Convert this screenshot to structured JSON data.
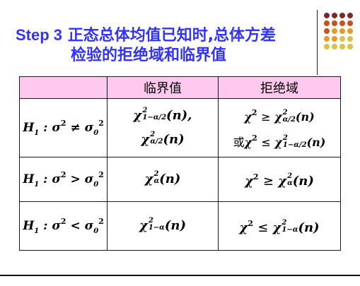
{
  "title": {
    "step": "Step 3",
    "line1": "正态总体均值已知时,总体方差",
    "line2": "检验的拒绝域和临界值"
  },
  "table": {
    "headers": [
      "",
      "临界值",
      "拒绝域"
    ],
    "rows": [
      {
        "h1_rel": "≠",
        "critical": [
          "χ²₁₋α/₂(n),",
          "χ²α/₂(n)"
        ],
        "rejection": [
          "χ² ≥ χ²α/₂(n)",
          "或χ² ≤ χ²₁₋α/₂(n)"
        ]
      },
      {
        "h1_rel": ">",
        "critical": [
          "χ²α(n)"
        ],
        "rejection": [
          "χ² ≥ χ²α(n)"
        ]
      },
      {
        "h1_rel": "<",
        "critical": [
          "χ²₁₋α(n)"
        ],
        "rejection": [
          "χ² ≤ χ²₁₋α(n)"
        ]
      }
    ],
    "symbols": {
      "H": "H",
      "H_sub": "1",
      "colon": " : ",
      "sigma": "σ",
      "sq": "2",
      "zero": "0",
      "chi": "χ",
      "alpha_half": "α/2",
      "one_minus_alpha_half": "1−α/2",
      "alpha": "α",
      "one_minus_alpha": "1−α",
      "n_arg": "(n)",
      "comma": ",",
      "geq": "≥",
      "leq": "≤",
      "or": "或"
    }
  },
  "decoration": {
    "dot_colors": [
      "#7a2a2a",
      "#c8501e",
      "#e59a2a",
      "#d9c24a"
    ]
  }
}
